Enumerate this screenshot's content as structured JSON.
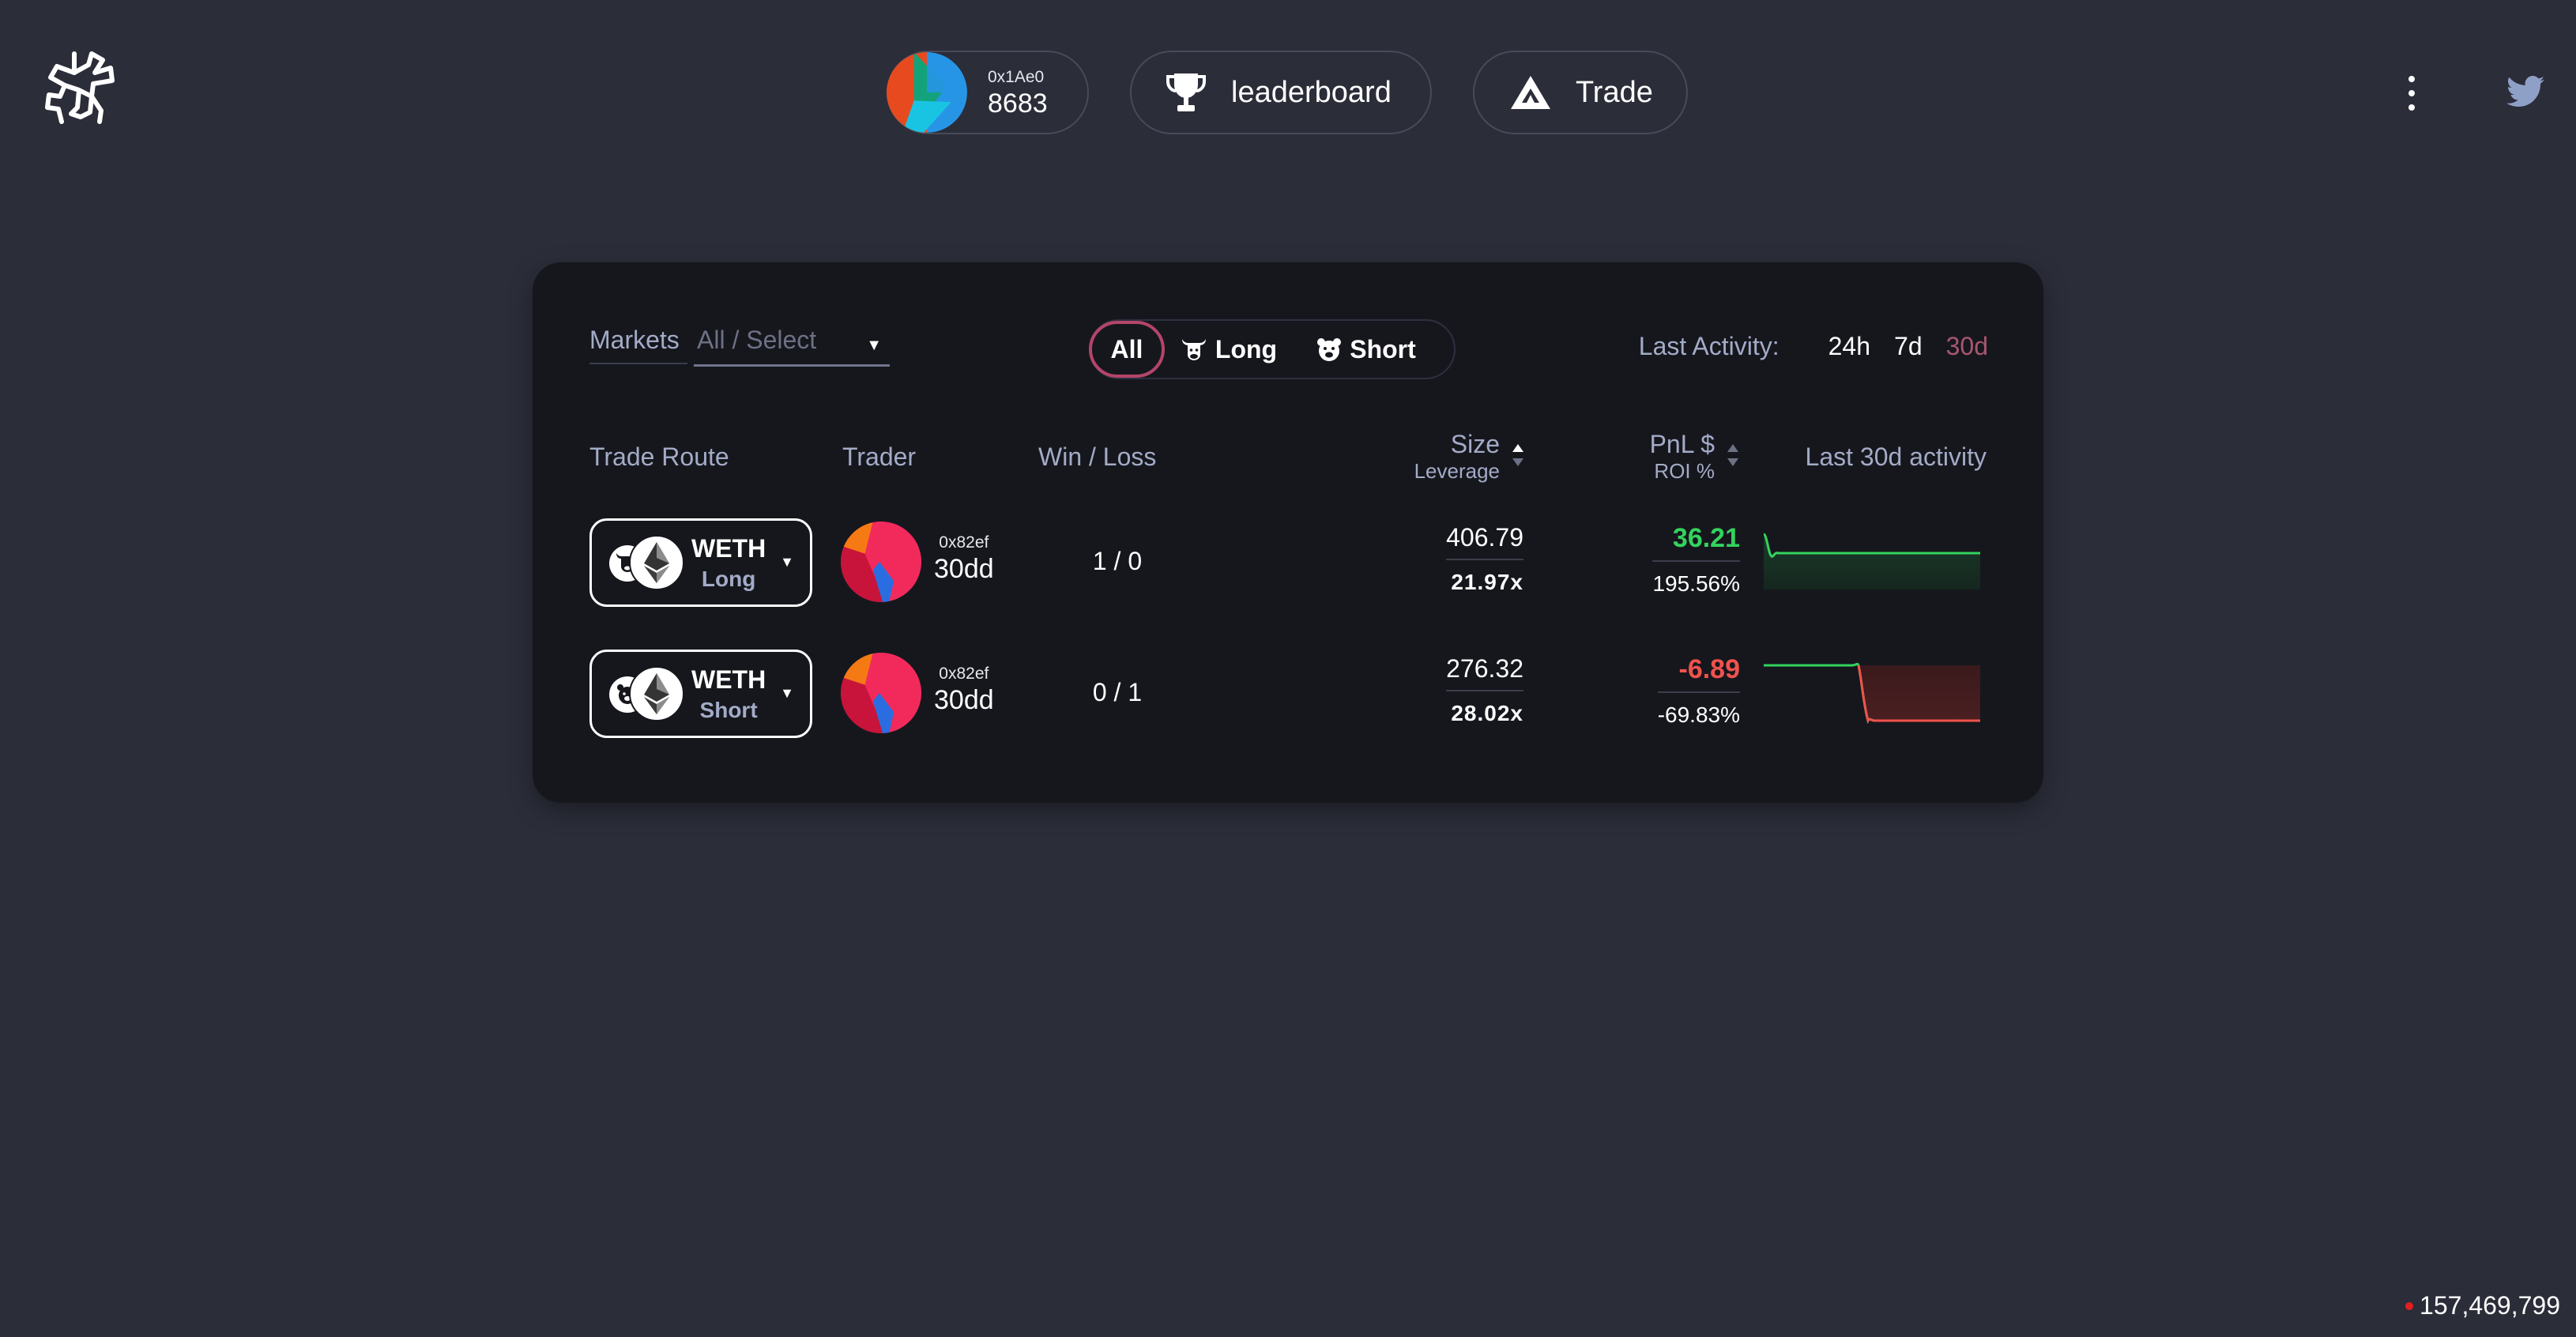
{
  "header": {
    "account": {
      "address": "0x1Ae0",
      "value": "8683"
    },
    "leaderboard_label": "leaderboard",
    "trade_label": "Trade",
    "icons": [
      "logo-icon",
      "trophy-icon",
      "trade-triangle-icon",
      "more-vertical-icon",
      "twitter-icon"
    ]
  },
  "filters": {
    "markets_label": "Markets",
    "markets_placeholder": "All / Select",
    "direction": {
      "all": "All",
      "long": "Long",
      "short": "Short",
      "selected": "All"
    },
    "activity_label": "Last Activity:",
    "activity_options": [
      "24h",
      "7d",
      "30d"
    ],
    "activity_selected": "30d"
  },
  "table": {
    "headers": {
      "route": "Trade Route",
      "trader": "Trader",
      "winloss": "Win / Loss",
      "size": "Size",
      "leverage": "Leverage",
      "pnl": "PnL $",
      "roi": "ROI %",
      "activity": "Last 30d activity"
    },
    "rows": [
      {
        "asset": "WETH",
        "direction": "Long",
        "trader_addr": "0x82ef",
        "trader_name": "30dd",
        "winloss": "1 / 0",
        "size": "406.79",
        "leverage": "21.97x",
        "pnl": "36.21",
        "roi": "195.56%",
        "pnl_color": "#33d35e"
      },
      {
        "asset": "WETH",
        "direction": "Short",
        "trader_addr": "0x82ef",
        "trader_name": "30dd",
        "winloss": "0 / 1",
        "size": "276.32",
        "leverage": "28.02x",
        "pnl": "-6.89",
        "roi": "-69.83%",
        "pnl_color": "#f0524d"
      }
    ]
  },
  "footer": {
    "block_number": "157,469,799"
  },
  "colors": {
    "accent": "#b4456a",
    "positive": "#33d35e",
    "negative": "#f0524d",
    "background": "#2b2d39",
    "panel": "#16171d"
  }
}
